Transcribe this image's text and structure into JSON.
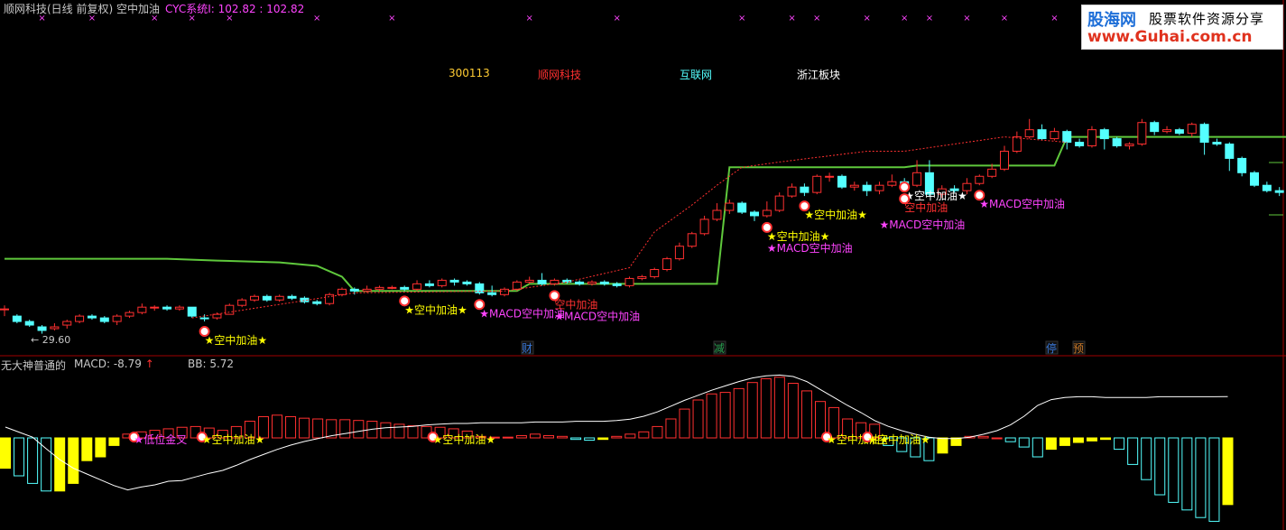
{
  "header": {
    "title": "顺网科技(日线 前复权) 空中加油",
    "cyc_label": "CYC系统I: 102.82 : 102.82"
  },
  "info_tags": {
    "code": "300113",
    "name": "顺网科技",
    "industry": "互联网",
    "region": "浙江板块"
  },
  "logo": {
    "name": "股海网",
    "slogan": "股票软件资源分享",
    "url": "www.Guhai.com.cn"
  },
  "lower_panel": {
    "name": "无大神普通的",
    "macd_label": "MACD: -8.79",
    "bb_label": "BB: 5.72"
  },
  "event_badges": [
    {
      "label": "财",
      "color": "#3a78d8"
    },
    {
      "label": "减",
      "color": "#28a050"
    },
    {
      "label": "停",
      "color": "#3a78d8"
    },
    {
      "label": "预",
      "color": "#c87828"
    }
  ],
  "chart_data": [
    {
      "type": "candlestick",
      "title": "顺网科技(日线 前复权) 空中加油",
      "low_marker": "29.60",
      "colors": {
        "up": "#ff3030",
        "down": "#54ffff",
        "cyc_line": "#5fc83c",
        "support": "#ff3030"
      },
      "candles": [
        [
          36.5,
          36.5,
          37.5,
          34.5
        ],
        [
          34.5,
          33.0,
          35.0,
          32.5
        ],
        [
          33.0,
          32.0,
          33.5,
          31.5
        ],
        [
          31.5,
          30.5,
          32.0,
          29.6
        ],
        [
          31.0,
          31.5,
          32.5,
          30.5
        ],
        [
          32.0,
          33.0,
          33.5,
          31.0
        ],
        [
          33.0,
          34.5,
          35.0,
          32.5
        ],
        [
          34.5,
          34.0,
          35.0,
          33.5
        ],
        [
          34.0,
          33.0,
          34.5,
          32.5
        ],
        [
          33.0,
          34.5,
          35.0,
          32.0
        ],
        [
          34.5,
          35.5,
          36.0,
          34.0
        ],
        [
          35.5,
          37.0,
          38.0,
          35.0
        ],
        [
          37.0,
          37.0,
          37.5,
          36.0
        ],
        [
          37.0,
          36.5,
          37.5,
          36.0
        ],
        [
          36.5,
          37.0,
          37.5,
          36.0
        ],
        [
          37.0,
          34.5,
          37.0,
          34.0
        ],
        [
          34.0,
          33.8,
          35.0,
          33.0
        ],
        [
          34.0,
          35.0,
          35.5,
          33.5
        ],
        [
          35.0,
          37.5,
          38.0,
          35.0
        ],
        [
          37.5,
          39.0,
          39.5,
          37.0
        ],
        [
          39.0,
          40.0,
          40.5,
          38.5
        ],
        [
          40.0,
          39.0,
          40.5,
          38.5
        ],
        [
          39.0,
          40.0,
          40.5,
          38.5
        ],
        [
          40.0,
          39.5,
          40.5,
          39.0
        ],
        [
          39.5,
          38.5,
          40.0,
          38.0
        ],
        [
          38.5,
          38.0,
          39.0,
          37.5
        ],
        [
          38.0,
          40.5,
          41.0,
          37.5
        ],
        [
          40.5,
          42.0,
          42.5,
          40.0
        ],
        [
          42.0,
          41.5,
          42.5,
          40.5
        ],
        [
          41.5,
          42.0,
          43.0,
          41.0
        ],
        [
          42.0,
          42.5,
          43.0,
          41.5
        ],
        [
          42.5,
          42.5,
          43.0,
          42.0
        ],
        [
          42.5,
          42.0,
          43.0,
          41.5
        ],
        [
          42.0,
          43.5,
          44.5,
          41.5
        ],
        [
          43.5,
          43.0,
          44.5,
          42.5
        ],
        [
          43.0,
          44.5,
          45.0,
          42.5
        ],
        [
          44.5,
          44.0,
          45.0,
          43.0
        ],
        [
          44.0,
          43.5,
          44.5,
          43.0
        ],
        [
          43.5,
          41.0,
          44.0,
          40.5
        ],
        [
          41.0,
          40.5,
          43.0,
          40.0
        ],
        [
          40.5,
          42.0,
          42.5,
          40.0
        ],
        [
          42.0,
          44.0,
          44.5,
          41.5
        ],
        [
          44.0,
          44.5,
          45.5,
          43.5
        ],
        [
          44.5,
          43.5,
          46.5,
          43.0
        ],
        [
          43.5,
          44.5,
          45.0,
          43.0
        ],
        [
          44.5,
          44.0,
          45.0,
          43.5
        ],
        [
          44.0,
          43.5,
          44.5,
          43.0
        ],
        [
          43.5,
          44.0,
          44.5,
          43.0
        ],
        [
          44.0,
          43.5,
          44.5,
          43.0
        ],
        [
          43.5,
          43.0,
          44.0,
          42.5
        ],
        [
          43.0,
          45.0,
          45.5,
          42.5
        ],
        [
          45.0,
          45.5,
          46.0,
          44.5
        ],
        [
          45.5,
          47.5,
          48.0,
          45.0
        ],
        [
          47.5,
          50.5,
          51.0,
          47.0
        ],
        [
          50.5,
          54.0,
          55.0,
          50.0
        ],
        [
          54.0,
          57.5,
          58.0,
          53.5
        ],
        [
          57.5,
          61.5,
          62.5,
          57.0
        ],
        [
          61.5,
          64.0,
          66.0,
          61.0
        ],
        [
          64.0,
          66.0,
          67.0,
          63.0
        ],
        [
          66.0,
          63.5,
          66.5,
          63.0
        ],
        [
          63.5,
          62.5,
          64.0,
          61.0
        ],
        [
          62.5,
          64.0,
          66.5,
          62.0
        ],
        [
          64.0,
          68.0,
          69.0,
          63.5
        ],
        [
          68.0,
          70.5,
          71.5,
          67.5
        ],
        [
          70.5,
          69.0,
          71.5,
          68.0
        ],
        [
          69.0,
          73.5,
          74.0,
          68.5
        ],
        [
          73.5,
          73.5,
          74.5,
          72.0
        ],
        [
          73.5,
          70.5,
          74.0,
          70.0
        ],
        [
          70.5,
          71.0,
          72.0,
          69.5
        ],
        [
          71.0,
          69.5,
          72.0,
          68.0
        ],
        [
          69.5,
          71.0,
          72.0,
          68.5
        ],
        [
          71.0,
          72.0,
          74.0,
          70.5
        ],
        [
          72.0,
          71.0,
          73.0,
          70.0
        ],
        [
          71.0,
          74.5,
          78.0,
          70.5
        ],
        [
          74.5,
          68.5,
          78.0,
          68.0
        ],
        [
          68.5,
          70.0,
          71.0,
          67.5
        ],
        [
          70.0,
          69.5,
          71.0,
          69.0
        ],
        [
          69.5,
          71.5,
          73.0,
          68.5
        ],
        [
          71.5,
          73.5,
          74.0,
          71.0
        ],
        [
          73.5,
          75.5,
          77.0,
          73.0
        ],
        [
          75.5,
          80.5,
          82.0,
          75.0
        ],
        [
          80.5,
          84.5,
          86.0,
          80.0
        ],
        [
          84.5,
          86.5,
          89.5,
          84.0
        ],
        [
          86.5,
          84.0,
          88.0,
          83.5
        ],
        [
          84.0,
          86.0,
          87.0,
          83.5
        ],
        [
          86.0,
          83.0,
          86.5,
          81.0
        ],
        [
          83.0,
          82.0,
          84.0,
          81.5
        ],
        [
          82.0,
          86.5,
          87.5,
          81.5
        ],
        [
          86.5,
          84.0,
          87.0,
          81.0
        ],
        [
          84.0,
          82.0,
          84.5,
          81.5
        ],
        [
          82.0,
          82.5,
          83.0,
          81.0
        ],
        [
          82.5,
          88.5,
          89.5,
          82.0
        ],
        [
          88.5,
          86.0,
          89.0,
          85.0
        ],
        [
          86.0,
          86.5,
          87.5,
          85.5
        ],
        [
          86.5,
          85.5,
          87.0,
          85.0
        ],
        [
          85.5,
          88.0,
          88.5,
          84.5
        ],
        [
          88.0,
          83.0,
          88.5,
          79.5
        ],
        [
          83.0,
          82.5,
          84.0,
          82.0
        ],
        [
          82.5,
          78.5,
          83.0,
          75.0
        ],
        [
          78.5,
          74.5,
          79.0,
          73.5
        ],
        [
          74.5,
          71.0,
          75.0,
          70.5
        ],
        [
          71.0,
          69.5,
          72.0,
          69.0
        ],
        [
          69.5,
          69.0,
          70.5,
          68.0
        ],
        [
          69.0,
          73.5,
          74.0,
          68.5
        ]
      ],
      "cyc_line": [
        [
          0,
          50.5
        ],
        [
          13,
          50.5
        ],
        [
          17,
          50.0
        ],
        [
          22,
          49.5
        ],
        [
          25,
          48.5
        ],
        [
          27,
          45.5
        ],
        [
          28,
          41.5
        ],
        [
          35,
          41.5
        ],
        [
          41,
          41.5
        ],
        [
          42,
          43.5
        ],
        [
          57,
          43.5
        ],
        [
          58,
          76.0
        ],
        [
          72,
          76.0
        ],
        [
          73,
          76.5
        ],
        [
          84,
          76.5
        ],
        [
          85,
          84.5
        ],
        [
          104,
          84.5
        ]
      ],
      "support_line": [
        [
          15,
          34.0
        ],
        [
          28,
          41.0
        ],
        [
          40,
          41.5
        ],
        [
          45,
          44.0
        ],
        [
          50,
          48.0
        ],
        [
          52,
          58.0
        ],
        [
          55,
          65.5
        ],
        [
          57,
          71.0
        ],
        [
          59,
          76.0
        ],
        [
          62,
          77.5
        ],
        [
          69,
          80.5
        ],
        [
          72,
          80.5
        ],
        [
          75,
          82.0
        ],
        [
          80,
          84.5
        ],
        [
          85,
          83.0
        ]
      ],
      "signals": [
        {
          "i": 16,
          "text": "★空中加油★",
          "color": "#ffff00",
          "offset": 1
        },
        {
          "i": 32,
          "text": "★空中加油★",
          "color": "#ffff00",
          "offset": 1
        },
        {
          "i": 38,
          "text": "★MACD空中加油",
          "color": "#ff44ff",
          "offset": 1
        },
        {
          "i": 44,
          "text": "★MACD空中加油",
          "color": "#ff44ff",
          "offset": 2
        },
        {
          "i": 44,
          "text": "空中加油",
          "color": "#ff3030",
          "offset": 1
        },
        {
          "i": 61,
          "text": "★空中加油★",
          "color": "#ffff00",
          "offset": 1
        },
        {
          "i": 61,
          "text": "★MACD空中加油",
          "color": "#ff44ff",
          "offset": 2
        },
        {
          "i": 64,
          "text": "★空中加油★",
          "color": "#ffff00",
          "offset": 1
        },
        {
          "i": 70,
          "text": "★MACD空中加油",
          "color": "#ff44ff",
          "offset": 2
        },
        {
          "i": 72,
          "text": "★空中加油★",
          "color": "#ffffff",
          "offset": 0
        },
        {
          "i": 72,
          "text": "空中加油",
          "color": "#ff3030",
          "offset": 1
        },
        {
          "i": 78,
          "text": "★MACD空中加油",
          "color": "#ff44ff",
          "offset": 1
        }
      ]
    },
    {
      "type": "bar",
      "title": "MACD",
      "series": [
        {
          "name": "MACD",
          "values": [
            -4,
            -5,
            -6,
            -7,
            -7,
            -6,
            -3,
            -2.5,
            -1,
            0.5,
            0.8,
            1.0,
            1.2,
            1.4,
            1.5,
            1.3,
            1.0,
            1.5,
            2.2,
            2.8,
            3.0,
            2.8,
            2.6,
            2.5,
            2.4,
            2.4,
            2.3,
            2.2,
            2.0,
            1.8,
            1.6,
            1.5,
            1.4,
            1.2,
            0.9,
            0.2,
            0.1,
            0.1,
            0.3,
            0.5,
            0.3,
            0.2,
            -0.2,
            -0.3,
            -0.2,
            0.2,
            0.5,
            0.8,
            1.5,
            2.5,
            3.8,
            5.0,
            5.8,
            6.0,
            6.5,
            7.3,
            7.8,
            8.0,
            7.2,
            6.2,
            4.8,
            4.0,
            2.5,
            2.0,
            1.8,
            -1.0,
            -1.8,
            -2.5,
            -3.0,
            -2.0,
            -1.0,
            0.2,
            0.2,
            0,
            -0.5,
            -1.2,
            -2.5,
            -1.5,
            -1.0,
            -0.6,
            -0.4,
            -0.2,
            -1.5,
            -3.5,
            -5.5,
            -7.5,
            -8.5,
            -9.5,
            -10.5,
            -11.0,
            -8.79
          ]
        },
        {
          "name": "BB",
          "values": [
            1.5,
            0.8,
            0.1,
            -1.5,
            -3.0,
            -4.2,
            -5.0,
            -5.8,
            -6.6,
            -7.2,
            -6.8,
            -6.5,
            -6.0,
            -5.9,
            -5.4,
            -4.9,
            -4.5,
            -3.8,
            -3.0,
            -2.3,
            -1.6,
            -1.0,
            -0.5,
            -0.1,
            0.3,
            0.6,
            0.9,
            1.2,
            1.4,
            1.5,
            1.6,
            1.8,
            1.9,
            2.0,
            2.0,
            2.1,
            2.1,
            2.1,
            2.1,
            2.2,
            2.2,
            2.2,
            2.3,
            2.3,
            2.3,
            2.4,
            2.6,
            3.0,
            3.6,
            4.4,
            5.2,
            5.9,
            6.6,
            7.2,
            7.8,
            8.3,
            8.6,
            8.7,
            8.5,
            7.8,
            6.7,
            5.6,
            4.5,
            3.5,
            2.4,
            1.6,
            1.0,
            0.5,
            0.1,
            -0.1,
            -0.1,
            0.1,
            0.5,
            1.0,
            1.8,
            3.0,
            4.5,
            5.3,
            5.6,
            5.7,
            5.7,
            5.6,
            5.6,
            5.6,
            5.6,
            5.7,
            5.7,
            5.7,
            5.7,
            5.7,
            5.72
          ]
        }
      ],
      "signals": [
        {
          "i": 10,
          "text": "★低位金叉",
          "color": "#ff44ff"
        },
        {
          "i": 15,
          "text": "★空中加油★",
          "color": "#ffff00"
        },
        {
          "i": 32,
          "text": "★空中加油★",
          "color": "#ffff00"
        },
        {
          "i": 61,
          "text": "★空中加油★",
          "color": "#ffff00"
        },
        {
          "i": 64,
          "text": "★空中加油★",
          "color": "#ffff00"
        }
      ]
    }
  ]
}
